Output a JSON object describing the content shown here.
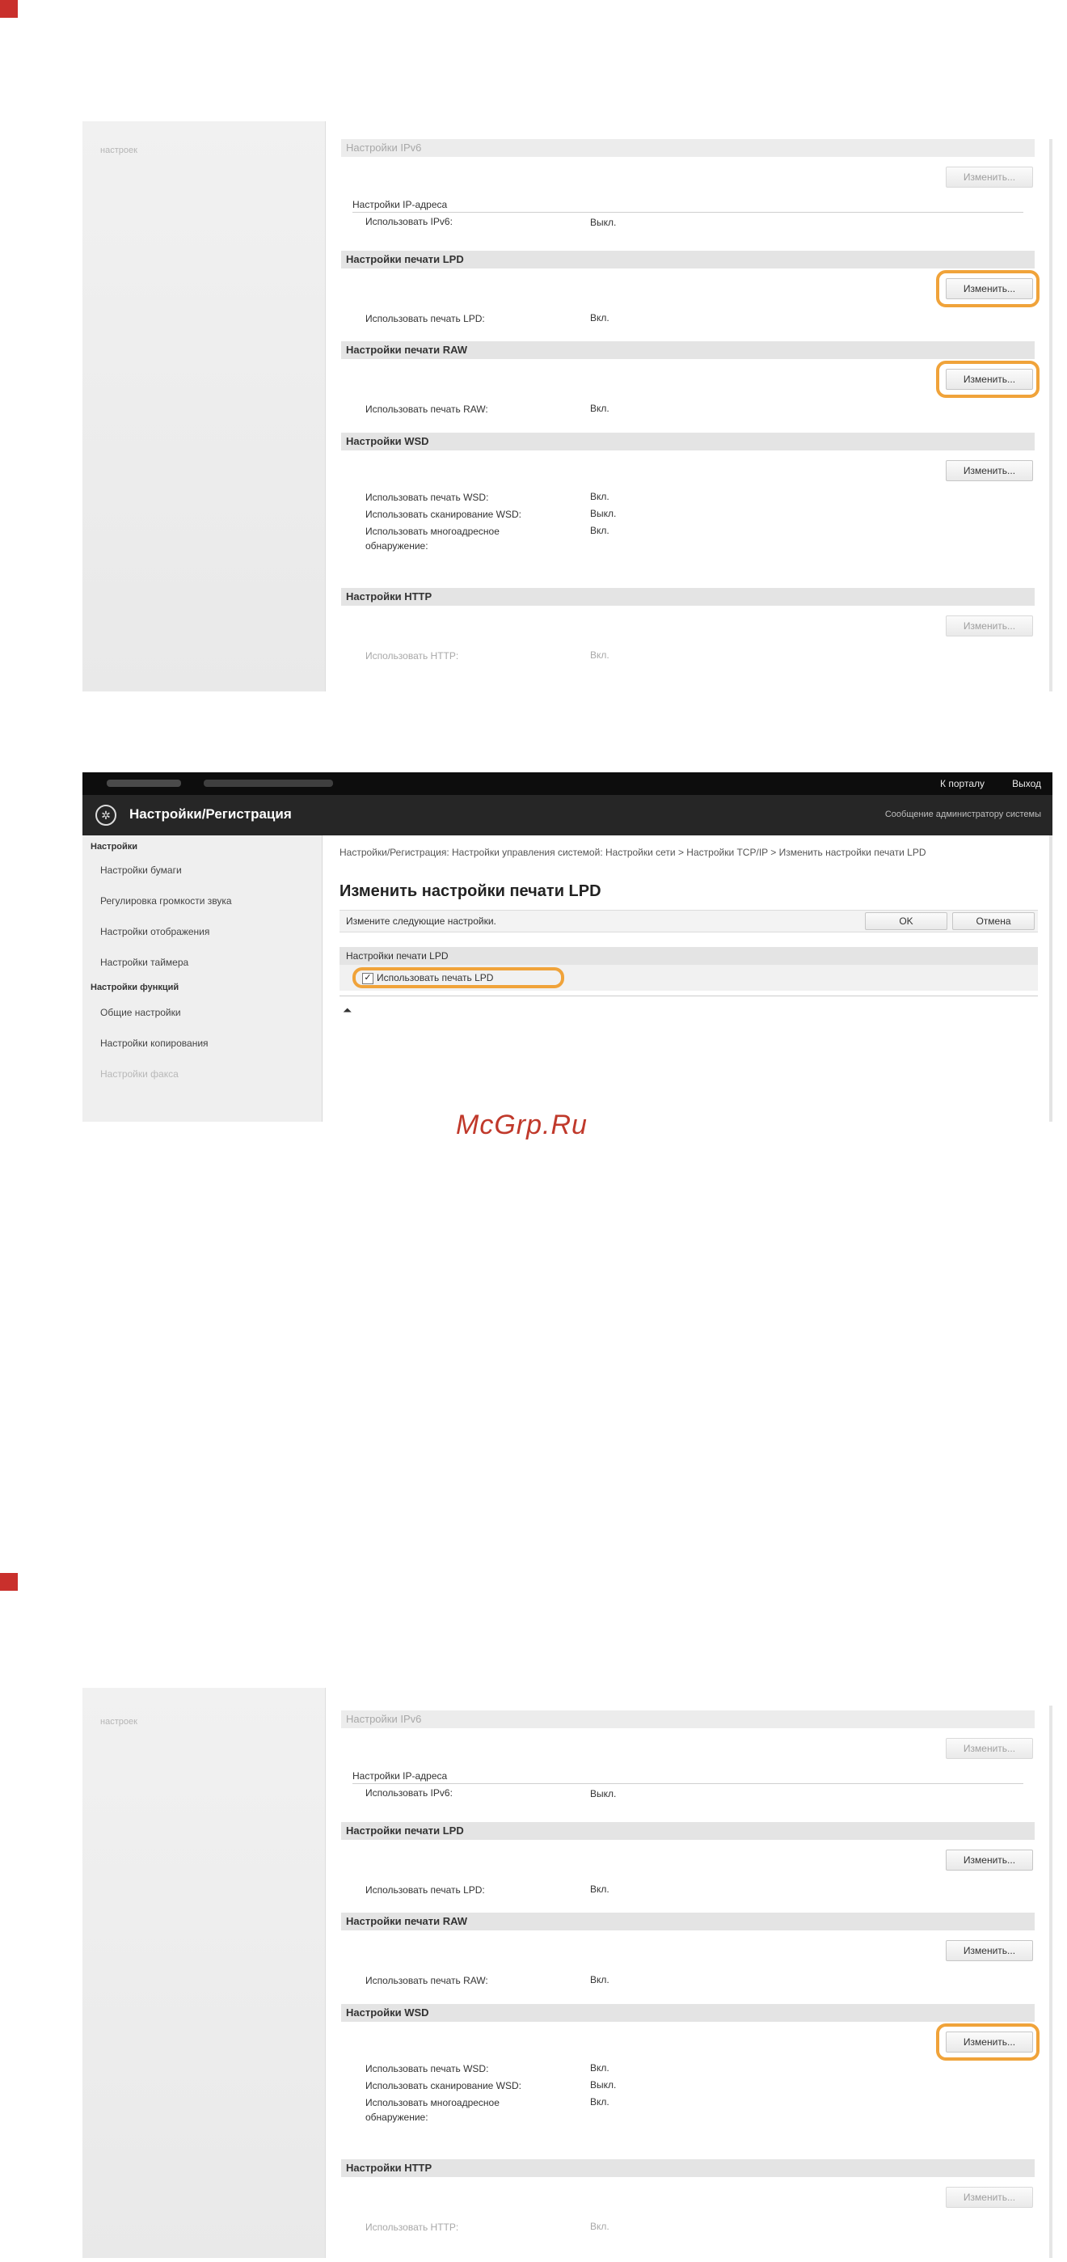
{
  "watermark": "McGrp.Ru",
  "colors": {
    "highlight": "#f0a33a",
    "step_marker": "#c9302c",
    "header_dark": "#262626"
  },
  "shot1": {
    "nav_faint": "настроек",
    "ipv6_bar": "Настройки IPv6",
    "ipv6_button": "Изменить...",
    "ip_address_subhead": "Настройки IP-адреса",
    "ipv6_row_label": "Использовать IPv6:",
    "ipv6_row_value": "Выкл.",
    "lpd_bar": "Настройки печати LPD",
    "lpd_button": "Изменить...",
    "lpd_row_label": "Использовать печать LPD:",
    "lpd_row_value": "Вкл.",
    "raw_bar": "Настройки печати RAW",
    "raw_button": "Изменить...",
    "raw_row_label": "Использовать печать RAW:",
    "raw_row_value": "Вкл.",
    "wsd_bar": "Настройки WSD",
    "wsd_button": "Изменить...",
    "wsd_print_label": "Использовать печать WSD:",
    "wsd_print_value": "Вкл.",
    "wsd_scan_label": "Использовать сканирование WSD:",
    "wsd_scan_value": "Выкл.",
    "wsd_multi_label_1": "Использовать многоадресное",
    "wsd_multi_label_2": "обнаружение:",
    "wsd_multi_value": "Вкл.",
    "http_bar": "Настройки HTTP",
    "http_button": "Изменить...",
    "http_row_label": "Использовать HTTP:",
    "http_row_value": "Вкл."
  },
  "shot2": {
    "top_link_portal": "К порталу",
    "top_link_logout": "Выход",
    "app_title": "Настройки/Регистрация",
    "admin_msg": "Сообщение администратору системы",
    "nav_group_settings": "Настройки",
    "nav_items": [
      "Настройки бумаги",
      "Регулировка громкости звука",
      "Настройки отображения",
      "Настройки таймера"
    ],
    "nav_group_functions": "Настройки функций",
    "nav_items2": [
      "Общие настройки",
      "Настройки копирования",
      "Настройки факса"
    ],
    "breadcrumb": "Настройки/Регистрация: Настройки управления системой: Настройки сети > Настройки TCP/IP > Изменить настройки печати LPD",
    "page_title": "Изменить настройки печати LPD",
    "instruction": "Измените следующие настройки.",
    "ok_label": "OK",
    "cancel_label": "Отмена",
    "section_label": "Настройки печати LPD",
    "checkbox_label": "Использовать печать LPD",
    "checkbox_mark": "✓",
    "to_top_icon": "⏶"
  },
  "shot3": {
    "nav_faint": "настроек",
    "ipv6_bar": "Настройки IPv6",
    "ipv6_button": "Изменить...",
    "ip_address_subhead": "Настройки IP-адреса",
    "ipv6_row_label": "Использовать IPv6:",
    "ipv6_row_value": "Выкл.",
    "lpd_bar": "Настройки печати LPD",
    "lpd_button": "Изменить...",
    "lpd_row_label": "Использовать печать LPD:",
    "lpd_row_value": "Вкл.",
    "raw_bar": "Настройки печати RAW",
    "raw_button": "Изменить...",
    "raw_row_label": "Использовать печать RAW:",
    "raw_row_value": "Вкл.",
    "wsd_bar": "Настройки WSD",
    "wsd_button": "Изменить...",
    "wsd_print_label": "Использовать печать WSD:",
    "wsd_print_value": "Вкл.",
    "wsd_scan_label": "Использовать сканирование WSD:",
    "wsd_scan_value": "Выкл.",
    "wsd_multi_label_1": "Использовать многоадресное",
    "wsd_multi_label_2": "обнаружение:",
    "wsd_multi_value": "Вкл.",
    "http_bar": "Настройки HTTP",
    "http_button": "Изменить...",
    "http_row_label": "Использовать HTTP:",
    "http_row_value": "Вкл."
  }
}
